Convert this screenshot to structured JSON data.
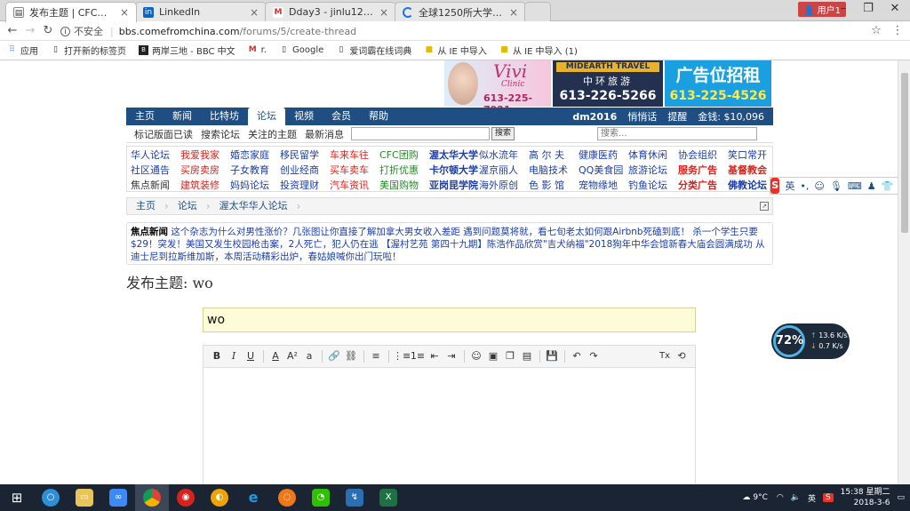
{
  "tabs": [
    {
      "label": "发布主题 | CFC中文网",
      "icon": "doc-icon",
      "active": true
    },
    {
      "label": "LinkedIn",
      "icon": "linkedin-icon",
      "active": false
    },
    {
      "label": "Dday3 - jinlu1228@gm",
      "icon": "gmail-icon",
      "active": false
    },
    {
      "label": "全球1250所大学2018排",
      "icon": "loading-icon",
      "active": false
    }
  ],
  "window": {
    "user_label": "用户1"
  },
  "address": {
    "insecure": "不安全",
    "domain": "bbs.comefromchina.com",
    "path": "/forums/5/create-thread"
  },
  "bookmarks": [
    "应用",
    "打开新的标签页",
    "两岸三地 - BBC 中文",
    "r.",
    "Google",
    "爱词霸在线词典",
    "从 IE 中导入",
    "从 IE 中导入 (1)"
  ],
  "ads": {
    "vivi_name": "Vivi",
    "vivi_sub": "Clinic",
    "vivi_phone": "613-225-7921",
    "travel_title": "MIDEARTH TRAVEL",
    "travel_cn": "中环旅游",
    "travel_phone": "613-226-5266",
    "rent_title": "广告位招租",
    "rent_phone": "613-225-4526"
  },
  "mainnav": {
    "items": [
      "主页",
      "新闻",
      "比特坊",
      "论坛",
      "视频",
      "会员",
      "帮助"
    ],
    "active_index": 3,
    "username": "dm2016",
    "messages": "悄悄话",
    "alerts": "提醒",
    "coins": "金钱: $10,096"
  },
  "subnav": {
    "items": [
      "标记版面已读",
      "搜索论坛",
      "关注的主题",
      "最新消息"
    ],
    "search_button": "搜索",
    "search_placeholder": "搜索..."
  },
  "forum_links": [
    [
      "华人论坛",
      "我爱我家",
      "婚恋家庭",
      "移民留学",
      "车来车往",
      "CFC团购",
      "渥太华大学",
      "似水流年",
      "高 尔 夫",
      "健康医药",
      "体育休闲",
      "协会组织",
      "笑口常开"
    ],
    [
      "社区通告",
      "买房卖房",
      "子女教育",
      "创业经商",
      "买车卖车",
      "打折优惠",
      "卡尔顿大学",
      "渥京丽人",
      "电脑技术",
      "QQ美食园",
      "旅游论坛",
      "服务广告",
      "基督教会"
    ],
    [
      "焦点新闻",
      "建筑装修",
      "妈妈论坛",
      "投资理财",
      "汽车资讯",
      "美国购物",
      "亚岗昆学院",
      "海外原创",
      "色 影 馆",
      "宠物缘地",
      "钓鱼论坛",
      "分类广告",
      "佛教论坛"
    ]
  ],
  "forum_colors": {
    "red": "#d8231c",
    "green": "#2a8a2a",
    "blue": "#1c3da8",
    "dark": "#333333"
  },
  "breadcrumb": [
    "主页",
    "论坛",
    "渥太华华人论坛"
  ],
  "news": {
    "label": "焦点新闻",
    "text": "这个杂志为什么对男性涨价？几张图让你直接了解加拿大男女收入差距 遇到问题莫将就，看七旬老太如何跟Airbnb死磕到底！ 杀一个学生只要$29！突发！美国又发生校园枪击案，2人死亡，犯人仍在逃 【渥村艺苑 第四十九期】陈浩作品欣赏\"吉犬纳福\"2018狗年中华会馆新春大庙会圆满成功 从迪士尼到拉斯维加斯，本周活动精彩出炉，春姑娘喊你出门玩啦！"
  },
  "form": {
    "heading": "发布主题: wo",
    "subject_value": "wo"
  },
  "editor_tools": [
    "B",
    "I",
    "U",
    "A",
    "A²",
    "a",
    "🔗",
    "⛓",
    "≡",
    "⋮≡",
    "1≡",
    "⇤",
    "⇥",
    "☺",
    "▣",
    "❐",
    "▤",
    "💾",
    "↶",
    "↷",
    "Tx",
    "⟲"
  ],
  "ime": {
    "mode": "英"
  },
  "net": {
    "percent": "72%",
    "up": "13.6 K/s",
    "down": "0.7 K/s"
  },
  "tray": {
    "weather": "9°C",
    "lang": "英",
    "time": "15:38 星期二",
    "date": "2018-3-6"
  },
  "accent": "#1f4f82"
}
